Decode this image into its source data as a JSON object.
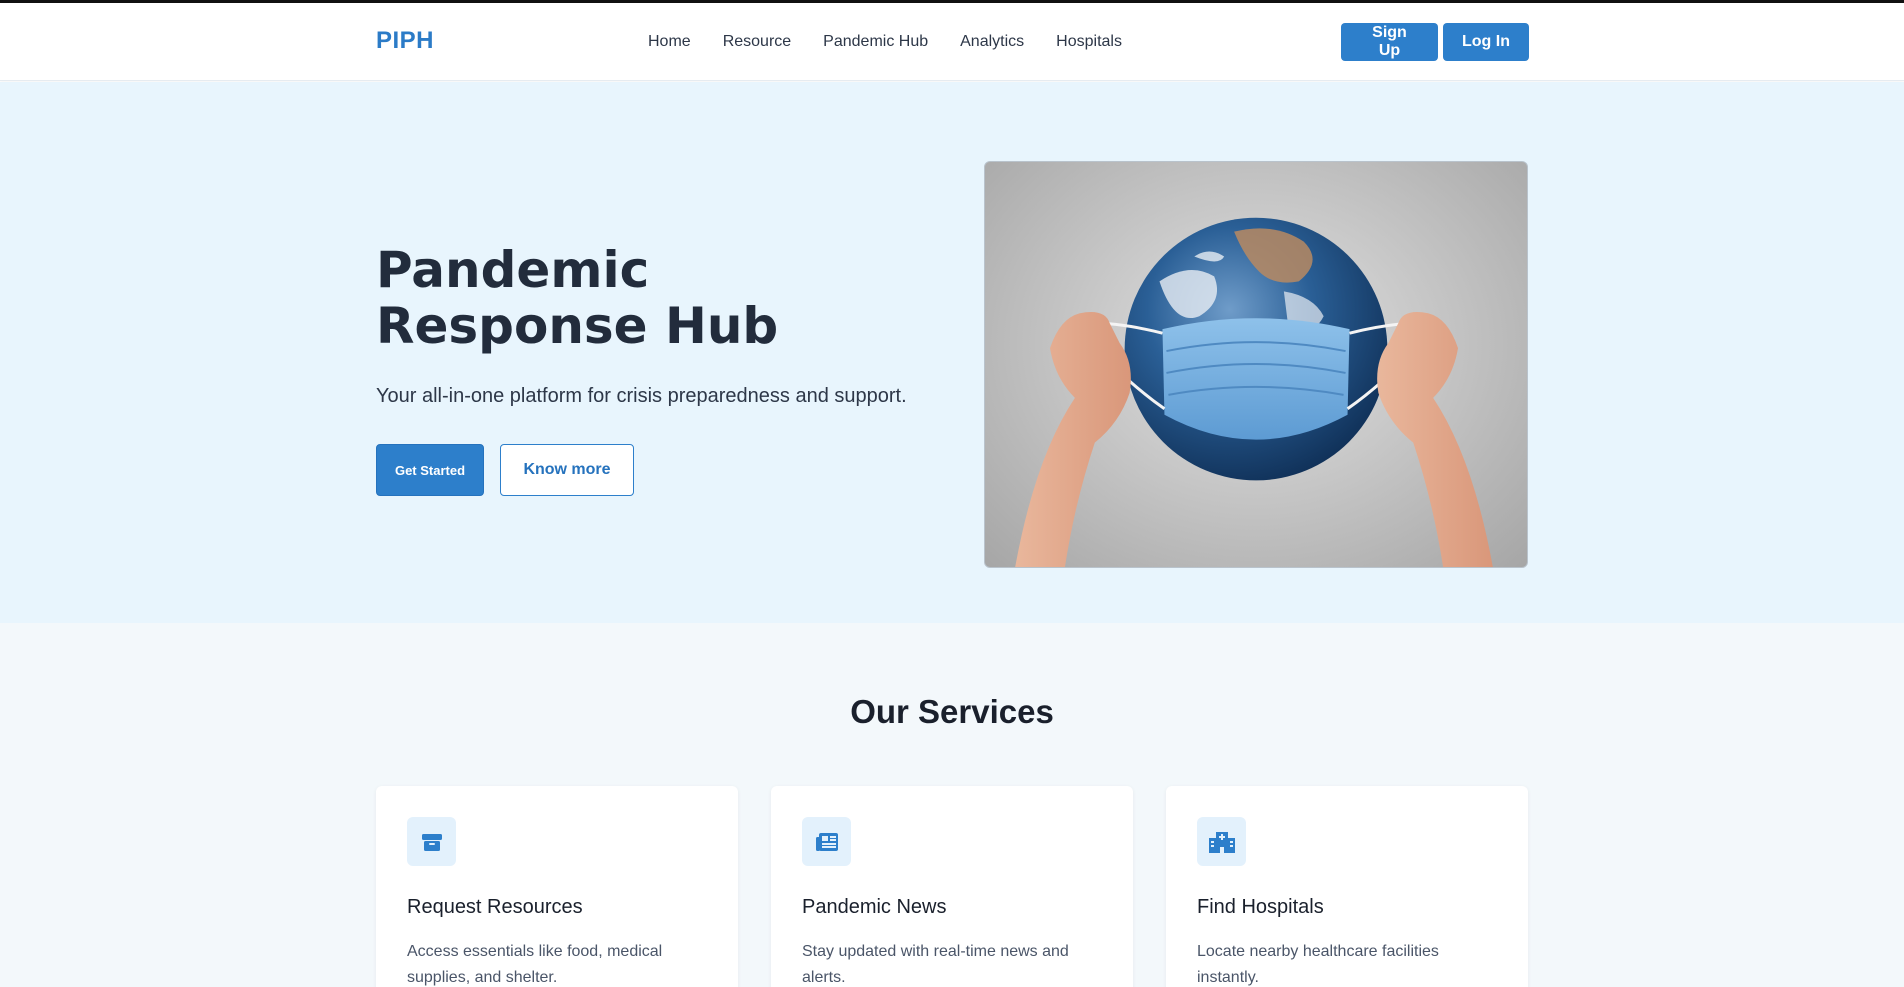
{
  "header": {
    "logo": "PIPH",
    "nav": [
      "Home",
      "Resource",
      "Pandemic Hub",
      "Analytics",
      "Hospitals"
    ],
    "signup_label": "Sign Up",
    "login_label": "Log In"
  },
  "hero": {
    "title": "Pandemic Response Hub",
    "subtitle": "Your all-in-one platform for crisis preparedness and support.",
    "primary_label": "Get Started",
    "secondary_label": "Know more",
    "image_subject": "earth-wearing-mask"
  },
  "services": {
    "title": "Our Services",
    "cards": [
      {
        "icon": "box-icon",
        "title": "Request Resources",
        "text": "Access essentials like food, medical supplies, and shelter."
      },
      {
        "icon": "newspaper-icon",
        "title": "Pandemic News",
        "text": "Stay updated with real-time news and alerts."
      },
      {
        "icon": "hospital-icon",
        "title": "Find Hospitals",
        "text": "Locate nearby healthcare facilities instantly."
      }
    ]
  },
  "colors": {
    "accent": "#2d7fcb",
    "hero_bg": "#e8f5fd",
    "services_bg": "#f3f8fb",
    "heading": "#222c3c"
  }
}
